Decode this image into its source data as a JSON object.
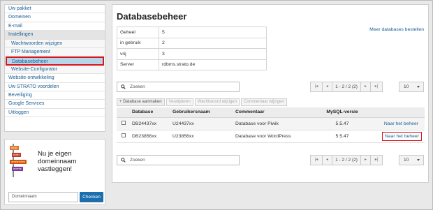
{
  "sidebar": {
    "items": [
      {
        "label": "Uw pakket",
        "type": "top"
      },
      {
        "label": "Domeinen",
        "type": "top"
      },
      {
        "label": "E-mail",
        "type": "top"
      },
      {
        "label": "Instellingen",
        "type": "grey"
      },
      {
        "label": "Wachtwoorden wijzigen",
        "type": "sub"
      },
      {
        "label": "FTP Management",
        "type": "sub"
      },
      {
        "label": "Databasebeheer",
        "type": "active"
      },
      {
        "label": "Website-Configurator",
        "type": "sub"
      },
      {
        "label": "Website-ontwikkeling",
        "type": "top"
      },
      {
        "label": "Uw STRATO voordelen",
        "type": "top"
      },
      {
        "label": "Beveiliging",
        "type": "top"
      },
      {
        "label": "Google Services",
        "type": "top"
      },
      {
        "label": "Uitloggen",
        "type": "top"
      }
    ]
  },
  "promo": {
    "signs": [
      "shop",
      "hotel",
      "amsterdam",
      "events"
    ],
    "text": "Nu je eigen domeinnaam vastleggen!",
    "input_placeholder": "Domeinnaam",
    "button": "Checken"
  },
  "main": {
    "title": "Databasebeheer",
    "more_link": "Meer databases bestellen",
    "info": [
      {
        "k": "Geheel",
        "v": "5"
      },
      {
        "k": "in gebruik",
        "v": "2"
      },
      {
        "k": "vrij",
        "v": "3"
      },
      {
        "k": "Server",
        "v": "rdbms.strato.de"
      }
    ],
    "search_placeholder": "Zoeken",
    "pager": {
      "first": "|◂",
      "prev": "◂",
      "text": "1 - 2 / 2 (2)",
      "next": "▸",
      "last": "▸|",
      "size": "10"
    },
    "toolbar": {
      "create": "+ Database aanmaken",
      "delete": "Verwijderen",
      "pw": "Wachtwoord wijzigen",
      "comment": "Commentaar wijzigen"
    },
    "columns": {
      "db": "Database",
      "user": "Gebruikersnaam",
      "comment": "Commentaar",
      "mysql": "MySQL-versie"
    },
    "rows": [
      {
        "db": "DB24437xx",
        "user": "U24437xx",
        "comment": "Database voor Piwik",
        "mysql": "5.5.47",
        "action": "Naar het beheer"
      },
      {
        "db": "DB23856xx",
        "user": "U23856xx",
        "comment": "Database voor WordPress",
        "mysql": "5.5.47",
        "action": "Naar het beheer"
      }
    ]
  },
  "colors": {
    "link": "#1b5e94",
    "highlight": "#d9151b",
    "active_bg": "#b7d4e8",
    "button": "#1b6fae"
  }
}
